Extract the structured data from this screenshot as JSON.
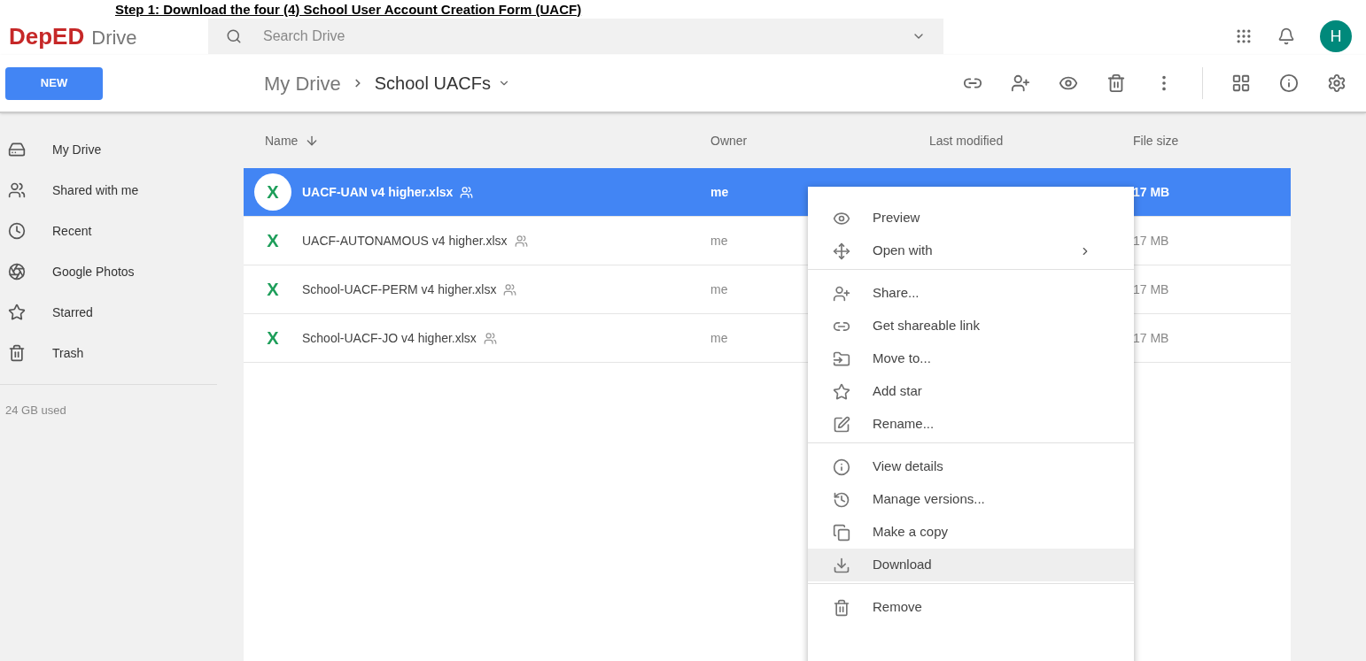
{
  "caption": "Step 1: Download the four (4) School User Account Creation Form (UACF)",
  "header": {
    "logo_text": "DepED",
    "app_name": "Drive",
    "search": {
      "placeholder": "Search Drive"
    },
    "avatar": "H"
  },
  "toolbar": {
    "new_button": "NEW",
    "breadcrumb": [
      {
        "label": "My Drive",
        "current": false
      },
      {
        "label": "School UACFs",
        "current": true
      }
    ]
  },
  "sidebar": {
    "items": [
      {
        "label": "My Drive",
        "kind": "drive",
        "selected": false
      },
      {
        "label": "Shared with me",
        "kind": "shared",
        "selected": false
      },
      {
        "label": "Recent",
        "kind": "recent",
        "selected": false
      },
      {
        "label": "Google Photos",
        "kind": "photos",
        "selected": false
      },
      {
        "label": "Starred",
        "kind": "star",
        "selected": false
      },
      {
        "label": "Trash",
        "kind": "trash",
        "selected": false
      }
    ],
    "storage": "24 GB used"
  },
  "table": {
    "columns": [
      "Name",
      "Owner",
      "Last modified",
      "File size"
    ],
    "rows": [
      {
        "type_letter": "X",
        "name": "UACF-UAN v4 higher.xlsx",
        "owner": "me",
        "size": "17 MB",
        "shared": true,
        "selected": true
      },
      {
        "type_letter": "X",
        "name": "UACF-AUTONAMOUS v4 higher.xlsx",
        "owner": "me",
        "size": "17 MB",
        "shared": true,
        "selected": false
      },
      {
        "type_letter": "X",
        "name": "School-UACF-PERM v4 higher.xlsx",
        "owner": "me",
        "size": "17 MB",
        "shared": true,
        "selected": false
      },
      {
        "type_letter": "X",
        "name": "School-UACF-JO v4 higher.xlsx",
        "owner": "me",
        "size": "17 MB",
        "shared": true,
        "selected": false
      }
    ]
  },
  "context_menu": {
    "groups": [
      [
        {
          "label": "Preview",
          "kind": "eye",
          "submenu": false,
          "selected": false
        },
        {
          "label": "Open with",
          "kind": "move",
          "submenu": true,
          "selected": false
        }
      ],
      [
        {
          "label": "Share...",
          "kind": "share",
          "submenu": false,
          "selected": false
        },
        {
          "label": "Get shareable link",
          "kind": "link",
          "submenu": false,
          "selected": false
        },
        {
          "label": "Move to...",
          "kind": "folder",
          "submenu": false,
          "selected": false
        },
        {
          "label": "Add star",
          "kind": "star",
          "submenu": false,
          "selected": false
        },
        {
          "label": "Rename...",
          "kind": "rename",
          "submenu": false,
          "selected": false
        }
      ],
      [
        {
          "label": "View details",
          "kind": "info",
          "submenu": false,
          "selected": false
        },
        {
          "label": "Manage versions...",
          "kind": "history",
          "submenu": false,
          "selected": false
        },
        {
          "label": "Make a copy",
          "kind": "copy",
          "submenu": false,
          "selected": false
        },
        {
          "label": "Download",
          "kind": "download",
          "submenu": false,
          "selected": true
        }
      ],
      [
        {
          "label": "Remove",
          "kind": "trash",
          "submenu": false,
          "selected": false
        }
      ]
    ]
  }
}
